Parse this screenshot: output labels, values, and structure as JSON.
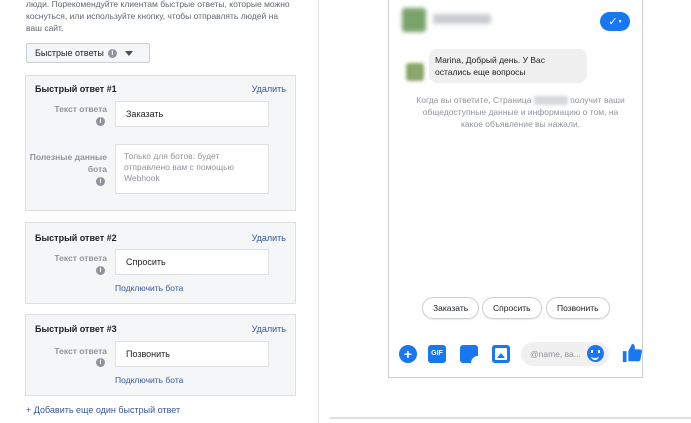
{
  "intro_text": "люди. Порекомендуйте клиентам быстрые ответы, которые можно коснуться, или используйте кнопку, чтобы отправлять людей на ваш сайт.",
  "quick_replies_dropdown": {
    "label": "Быстрые ответы",
    "info_glyph": "i"
  },
  "field_labels": {
    "reply_text": "Текст ответа",
    "payload": "Полезные данные бота",
    "info_glyph": "i"
  },
  "cards": [
    {
      "title": "Быстрый ответ #1",
      "delete_label": "Удалить",
      "reply_text": "Заказать",
      "payload_placeholder": "Только для ботов: будет отправлено вам с помощью Webhook"
    },
    {
      "title": "Быстрый ответ #2",
      "delete_label": "Удалить",
      "reply_text": "Спросить",
      "connect_bot_label": "Подключить бота"
    },
    {
      "title": "Быстрый ответ #3",
      "delete_label": "Удалить",
      "reply_text": "Позвонить",
      "connect_bot_label": "Подключить бота"
    }
  ],
  "add_reply_label": "+ Добавить еще один быстрый ответ",
  "preview": {
    "header_check_glyph": "✓",
    "header_caret_glyph": "▾",
    "message_text": "Marina, Добрый день. У Вас остались еще вопросы",
    "system_text_before": "Когда вы ответите, Страница",
    "system_text_after": "получит ваши общедоступные данные и информацию о том, на какое объявление вы нажали.",
    "quick_reply_chips": [
      "Заказать",
      "Спросить",
      "Позвонить"
    ],
    "composer": {
      "plus_glyph": "+",
      "gif_label": "GIF",
      "mention_placeholder": "@name, ва..."
    },
    "icons": [
      "check-icon",
      "plus-icon",
      "gif-icon",
      "sticker-icon",
      "image-icon",
      "emoji-icon",
      "thumbs-up-icon",
      "info-icon",
      "caret-down-icon"
    ]
  },
  "colors": {
    "accent": "#1877f2",
    "link": "#365899",
    "card_background": "#f5f6f7",
    "border": "#dddfe2",
    "muted_text": "#90949c"
  }
}
